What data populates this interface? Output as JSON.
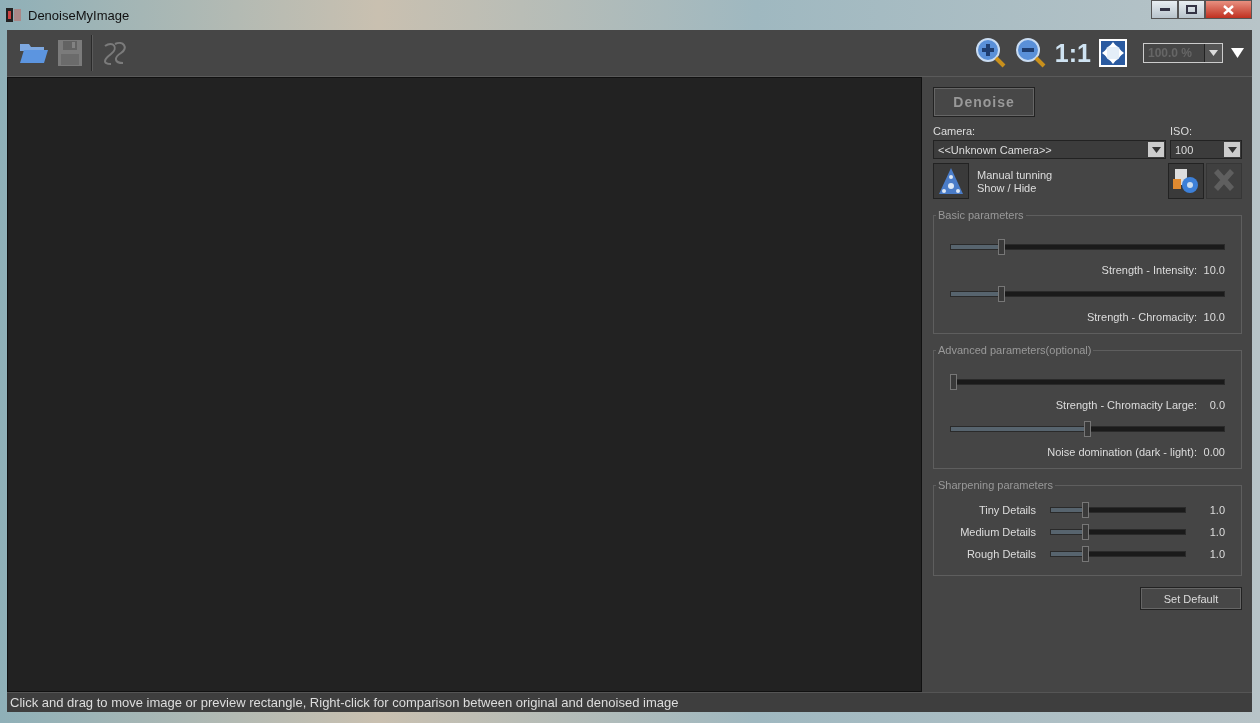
{
  "window": {
    "title": "DenoiseMyImage"
  },
  "toolbar": {
    "items": [
      {
        "kind": "open",
        "disabled": false
      },
      {
        "kind": "save",
        "disabled": true
      },
      {
        "kind": "logo",
        "disabled": true
      }
    ],
    "actual_size": "1:1",
    "zoom": {
      "value": "100.0 %",
      "disabled": true
    }
  },
  "side": {
    "denoise_button": {
      "label": "Denoise",
      "disabled": true
    },
    "camera": {
      "label": "Camera:",
      "value": "<<Unknown Camera>>"
    },
    "iso": {
      "label": "ISO:",
      "value": "100"
    },
    "manual": {
      "line1": "Manual tunning",
      "line2": "Show / Hide"
    },
    "tools": [
      {
        "kind": "settings",
        "disabled": false
      },
      {
        "kind": "reset",
        "disabled": true
      }
    ],
    "groups": [
      {
        "title": "Basic parameters",
        "kind": "stacked",
        "sliders": [
          {
            "label": "Strength - Intensity:",
            "reading": "10.0",
            "level": 0.18
          },
          {
            "label": "Strength - Chromacity:",
            "reading": "10.0",
            "level": 0.18
          }
        ]
      },
      {
        "title": "Advanced parameters(optional)",
        "kind": "stacked",
        "sliders": [
          {
            "label": "Strength - Chromacity Large:",
            "reading": "0.0",
            "level": 0.0
          },
          {
            "label": "Noise domination (dark - light):",
            "reading": "0.00",
            "level": 0.5
          }
        ]
      },
      {
        "title": "Sharpening parameters",
        "kind": "inline",
        "sliders": [
          {
            "label": "Tiny Details",
            "reading": "1.0",
            "level": 0.25
          },
          {
            "label": "Medium Details",
            "reading": "1.0",
            "level": 0.25
          },
          {
            "label": "Rough Details",
            "reading": "1.0",
            "level": 0.25
          }
        ]
      }
    ],
    "set_default": "Set Default"
  },
  "status_bar": "Click and drag to move image or preview rectangle, Right-click for comparison between original and denoised image"
}
